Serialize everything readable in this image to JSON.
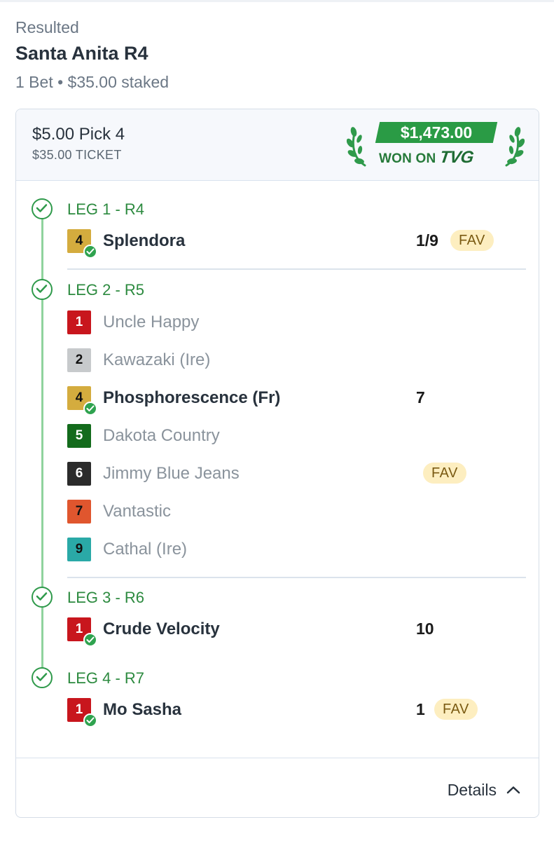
{
  "header": {
    "status": "Resulted",
    "race_title": "Santa Anita R4",
    "summary": "1 Bet • $35.00 staked"
  },
  "bet": {
    "type": "$5.00 Pick 4",
    "ticket": "$35.00 TICKET",
    "win_amount": "$1,473.00",
    "won_on": "WON ON",
    "brand": "TVG"
  },
  "legs": [
    {
      "label": "LEG 1 - R4",
      "runners": [
        {
          "number": "4",
          "name": "Splendora",
          "winner": true,
          "odds": "1/9",
          "fav": "FAV",
          "saddle_bg": "#d4ac3e",
          "saddle_fg": "#111111"
        }
      ]
    },
    {
      "label": "LEG 2 - R5",
      "runners": [
        {
          "number": "1",
          "name": "Uncle Happy",
          "winner": false,
          "saddle_bg": "#c8161d",
          "saddle_fg": "#ffffff"
        },
        {
          "number": "2",
          "name": "Kawazaki (Ire)",
          "winner": false,
          "saddle_bg": "#c7cacc",
          "saddle_fg": "#111111"
        },
        {
          "number": "4",
          "name": "Phosphorescence (Fr)",
          "winner": true,
          "odds": "7",
          "saddle_bg": "#d4ac3e",
          "saddle_fg": "#111111"
        },
        {
          "number": "5",
          "name": "Dakota Country",
          "winner": false,
          "saddle_bg": "#136b1c",
          "saddle_fg": "#ffffff"
        },
        {
          "number": "6",
          "name": "Jimmy Blue Jeans",
          "winner": false,
          "fav": "FAV",
          "saddle_bg": "#2b2b2b",
          "saddle_fg": "#ffffff"
        },
        {
          "number": "7",
          "name": "Vantastic",
          "winner": false,
          "saddle_bg": "#e0562e",
          "saddle_fg": "#111111"
        },
        {
          "number": "9",
          "name": "Cathal (Ire)",
          "winner": false,
          "saddle_bg": "#2aa9a7",
          "saddle_fg": "#111111"
        }
      ]
    },
    {
      "label": "LEG 3 - R6",
      "runners": [
        {
          "number": "1",
          "name": "Crude Velocity",
          "winner": true,
          "odds": "10",
          "saddle_bg": "#c8161d",
          "saddle_fg": "#ffffff"
        }
      ]
    },
    {
      "label": "LEG 4 - R7",
      "runners": [
        {
          "number": "1",
          "name": "Mo Sasha",
          "winner": true,
          "odds": "1",
          "fav": "FAV",
          "saddle_bg": "#c8161d",
          "saddle_fg": "#ffffff"
        }
      ]
    }
  ],
  "footer": {
    "details_label": "Details",
    "details_icon": "chevron-up-icon"
  },
  "colors": {
    "accent_green": "#2a9b45",
    "fav_bg": "#fdeec0",
    "timeline": "#8fd39d"
  }
}
